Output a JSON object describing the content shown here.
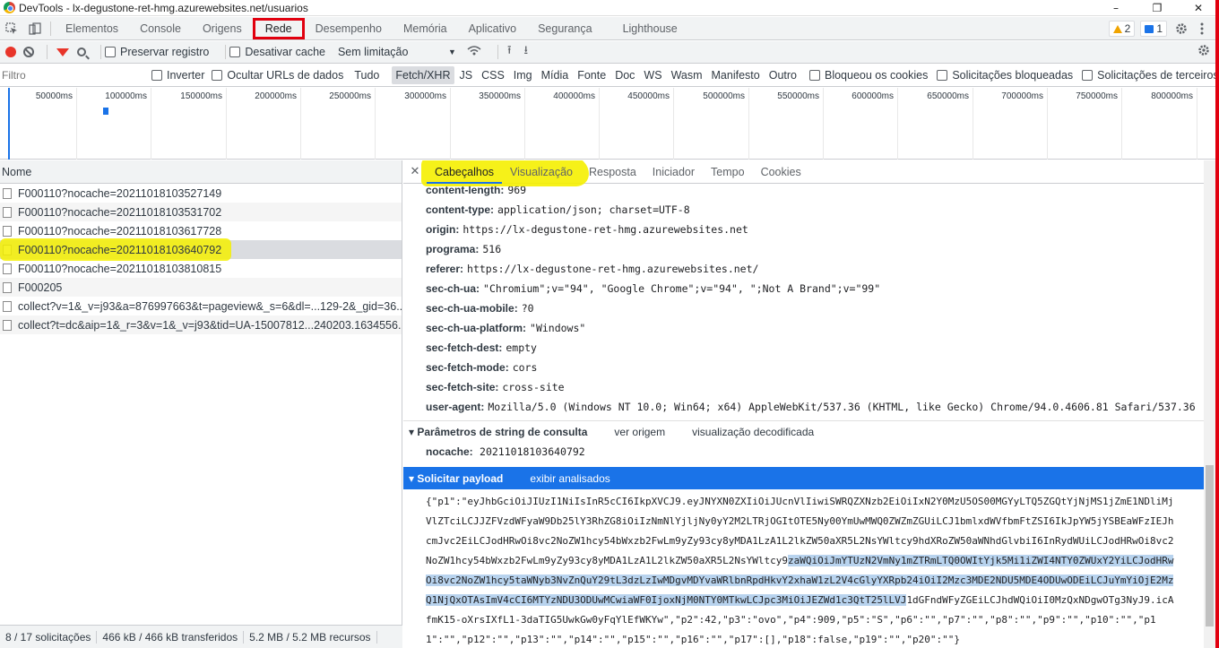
{
  "window": {
    "title": "DevTools - lx-degustone-ret-hmg.azurewebsites.net/usuarios",
    "minimize": "–",
    "maximize": "❐",
    "close": "✕"
  },
  "panel_tabs": [
    {
      "label": "Elementos"
    },
    {
      "label": "Console"
    },
    {
      "label": "Origens"
    },
    {
      "label": "Rede"
    },
    {
      "label": "Desempenho"
    },
    {
      "label": "Memória"
    },
    {
      "label": "Aplicativo"
    },
    {
      "label": "Segurança"
    },
    {
      "label": "Lighthouse"
    }
  ],
  "badges": {
    "warnings": "2",
    "messages": "1"
  },
  "toolbar": {
    "preserve_log": "Preservar registro",
    "disable_cache": "Desativar cache",
    "throttling": "Sem limitação"
  },
  "filterbar": {
    "placeholder": "Filtro",
    "invert": "Inverter",
    "hide_data_urls": "Ocultar URLs de dados",
    "types": [
      "Tudo",
      "Fetch/XHR",
      "JS",
      "CSS",
      "Img",
      "Mídia",
      "Fonte",
      "Doc",
      "WS",
      "Wasm",
      "Manifesto",
      "Outro"
    ],
    "active_type": "Fetch/XHR",
    "blocked_cookies": "Bloqueou os cookies",
    "blocked_requests": "Solicitações bloqueadas",
    "third_party": "Solicitações de terceiros"
  },
  "overview": {
    "ticks": [
      "50000ms",
      "100000ms",
      "150000ms",
      "200000ms",
      "250000ms",
      "300000ms",
      "350000ms",
      "400000ms",
      "450000ms",
      "500000ms",
      "550000ms",
      "600000ms",
      "650000ms",
      "700000ms",
      "750000ms",
      "800000ms"
    ]
  },
  "requests": {
    "column_name": "Nome",
    "rows": [
      "F000110?nocache=20211018103527149",
      "F000110?nocache=20211018103531702",
      "F000110?nocache=20211018103617728",
      "F000110?nocache=20211018103640792",
      "F000110?nocache=20211018103810815",
      "F000205",
      "collect?v=1&_v=j93&a=876997663&t=pageview&_s=6&dl=...129-2&_gid=36...",
      "collect?t=dc&aip=1&_r=3&v=1&_v=j93&tid=UA-15007812...240203.1634556..."
    ],
    "selected_index": 3
  },
  "footer": {
    "requests": "8 / 17 solicitações",
    "transferred": "466 kB / 466 kB transferidos",
    "resources": "5.2 MB / 5.2 MB recursos"
  },
  "detail_tabs": [
    {
      "label": "Cabeçalhos"
    },
    {
      "label": "Visualização"
    },
    {
      "label": "Resposta"
    },
    {
      "label": "Iniciador"
    },
    {
      "label": "Tempo"
    },
    {
      "label": "Cookies"
    }
  ],
  "headers": [
    {
      "key": "content-length:",
      "value": "969"
    },
    {
      "key": "content-type:",
      "value": "application/json; charset=UTF-8"
    },
    {
      "key": "origin:",
      "value": "https://lx-degustone-ret-hmg.azurewebsites.net"
    },
    {
      "key": "programa:",
      "value": "516"
    },
    {
      "key": "referer:",
      "value": "https://lx-degustone-ret-hmg.azurewebsites.net/"
    },
    {
      "key": "sec-ch-ua:",
      "value": "\"Chromium\";v=\"94\", \"Google Chrome\";v=\"94\", \";Not A Brand\";v=\"99\""
    },
    {
      "key": "sec-ch-ua-mobile:",
      "value": "?0"
    },
    {
      "key": "sec-ch-ua-platform:",
      "value": "\"Windows\""
    },
    {
      "key": "sec-fetch-dest:",
      "value": "empty"
    },
    {
      "key": "sec-fetch-mode:",
      "value": "cors"
    },
    {
      "key": "sec-fetch-site:",
      "value": "cross-site"
    },
    {
      "key": "user-agent:",
      "value": "Mozilla/5.0 (Windows NT 10.0; Win64; x64) AppleWebKit/537.36 (KHTML, like Gecko) Chrome/94.0.4606.81 Safari/537.36"
    }
  ],
  "query_section": {
    "title": "▾ Parâmetros de string de consulta",
    "view_source": "ver origem",
    "view_decoded": "visualização decodificada",
    "params": [
      {
        "key": "nocache:",
        "value": "20211018103640792"
      }
    ]
  },
  "payload_section": {
    "title": "▾ Solicitar payload",
    "view_parsed": "exibir analisados",
    "text_before": "{\"p1\":\"eyJhbGciOiJIUzI1NiIsInR5cCI6IkpXVCJ9.eyJNYXN0ZXIiOiJUcnVlIiwiSWRQZXNzb2EiOiIxN2Y0MzU5OS00MGYyLTQ5ZGQtYjNjMS1jZmE1NDliMjVlZTciLCJJZFVzdWFyaW9Db25lY3RhZG8iOiIzNmNlYjljNy0yY2M2LTRjOGItOTE5Ny00YmUwMWQ0ZWZmZGUiLCJ1bmlxdWVfbmFtZSI6IkJpYW5jYSBEaWFzIEJhcmJvc2EiLCJodHRwOi8vc2NoZW1hcy54bWxzb2FwLm9yZy93cy8yMDA1LzA1L2lkZW50aXR5L2NsYWltcy9hdXRoZW50aWNhdGlvbiI6InRydWUiLCJodHRwOi8vc2NoZW1hcy54bWxzb2FwLm9yZy93cy8yMDA1LzA1L2lkZW50aXR5L2NsYWltcy9",
    "text_selected": "zaWQiOiJmYTUzN2VmNy1mZTRmLTQ0OWItYjk5Mi1iZWI4NTY0ZWUxY2YiLCJodHRwOi8vc2NoZW1hcy5taWNyb3NvZnQuY29tL3dzLzIwMDgvMDYvaWRlbnRpdHkvY2xhaW1zL2V4cGlyYXRpb24iOiI2Mzc3MDE2NDU5MDE4ODUwODEiLCJuYmYiOjE2MzQ1NjQxOTAsImV4cCI6MTYzNDU3ODUwMCwiaWF0IjoxNjM0NTY0MTkwLCJpc3MiOiJEZWd1c3QtT25lLVJ",
    "text_after": "1dGFndWFyZGEiLCJhdWQiOiI0MzQxNDgwOTg3NyJ9.icAfmK15-oXrsIXfL1-3daTIG5UwkGw0yFqYlEfWKYw\",\"p2\":42,\"p3\":\"ovo\",\"p4\":909,\"p5\":\"S\",\"p6\":\"\",\"p7\":\"\",\"p8\":\"\",\"p9\":\"\",\"p10\":\"\",\"p11\":\"\",\"p12\":\"\",\"p13\":\"\",\"p14\":\"\",\"p15\":\"\",\"p16\":\"\",\"p17\":[],\"p18\":false,\"p19\":\"\",\"p20\":\"\"}"
  },
  "colors": {
    "accent": "#1a73e8",
    "highlight_yellow": "#f5f000",
    "annotation_red": "#e1000f",
    "record_red": "#e8352a"
  }
}
